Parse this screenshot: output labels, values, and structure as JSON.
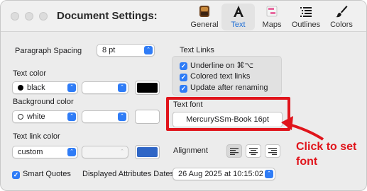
{
  "window": {
    "title": "Document Settings:"
  },
  "toolbar": {
    "tabs": [
      {
        "label": "General",
        "icon": "general-icon"
      },
      {
        "label": "Text",
        "icon": "text-A-icon",
        "active": true
      },
      {
        "label": "Maps",
        "icon": "maps-icon"
      },
      {
        "label": "Outlines",
        "icon": "outlines-icon"
      },
      {
        "label": "Colors",
        "icon": "colors-icon"
      }
    ]
  },
  "left": {
    "paragraph_spacing_label": "Paragraph Spacing",
    "paragraph_spacing_value": "8 pt",
    "text_color_label": "Text color",
    "text_color_value": "black",
    "background_color_label": "Background color",
    "background_color_value": "white",
    "text_link_color_label": "Text link color",
    "text_link_color_value": "custom"
  },
  "colors": {
    "text_swatch": "#000000",
    "background_swatch": "#ffffff",
    "link_swatch": "#2f66c6",
    "accent": "#2f7cf6",
    "annotation": "#e0141b"
  },
  "text_links": {
    "heading": "Text Links",
    "underline_label": "Underline on ⌘⌥",
    "colored_label": "Colored text links",
    "update_label": "Update after renaming"
  },
  "text_font": {
    "label": "Text font",
    "value": "MercurySSm-Book 16pt"
  },
  "alignment": {
    "label": "Alignment"
  },
  "bottom": {
    "smart_quotes_label": "Smart Quotes",
    "dates_label": "Displayed Attributes Dates",
    "dates_value": "26 Aug 2025 at 10:15:02"
  },
  "annotation": {
    "line1": "Click to set",
    "line2": "font"
  }
}
